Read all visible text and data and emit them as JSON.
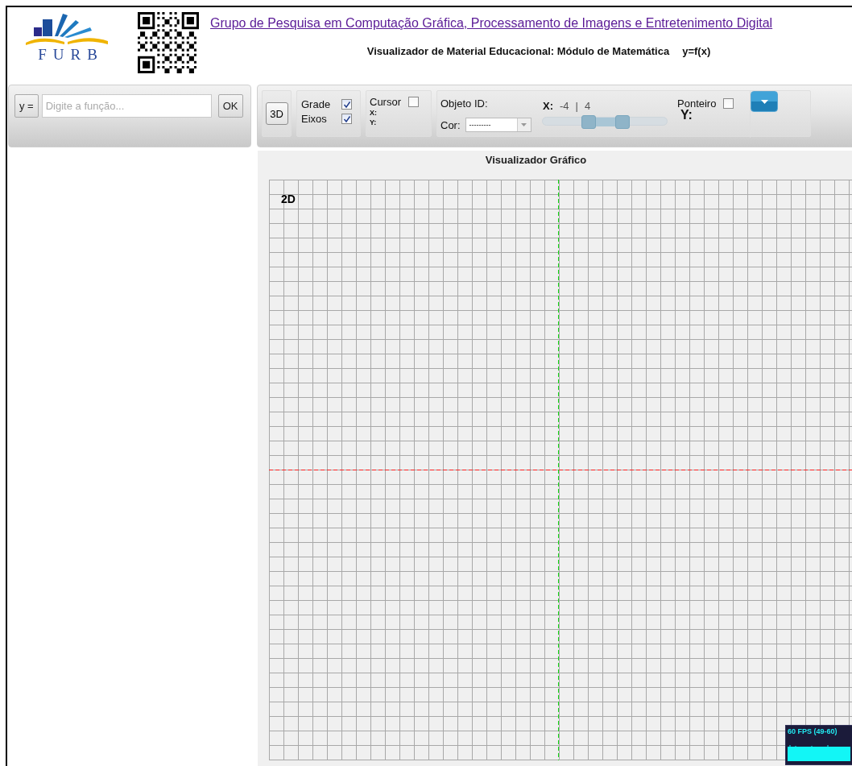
{
  "header": {
    "logo_text": "FURB",
    "link": "Grupo de Pesquisa em Computação Gráfica, Processamento de Imagens e Entretenimento Digital",
    "subtitle": "Visualizador de Material Educacional: Módulo de Matemática",
    "formula": "y=f(x)"
  },
  "function_bar": {
    "prefix_button": "y =",
    "input": {
      "placeholder": "Digite a função..."
    },
    "ok_button": "OK"
  },
  "toolbar": {
    "mode_button": "3D",
    "toggles": [
      {
        "label": "Grade",
        "checked": true
      },
      {
        "label": "Eixos",
        "checked": true
      }
    ],
    "cursor": {
      "label": "Cursor",
      "checked": false,
      "x_label": "X:",
      "y_label": "Y:"
    },
    "object": {
      "id_label": "Objeto ID:",
      "color_label": "Cor:",
      "color_select": "---------",
      "x_label": "X:",
      "x_min": "-4",
      "separator": "|",
      "x_max": "4",
      "thumbs": [
        {
          "level": 0.37
        },
        {
          "level": 0.64
        }
      ],
      "pointer": {
        "label": "Ponteiro",
        "checked": false
      },
      "y_label": "Y:"
    }
  },
  "graph": {
    "title": "Visualizador Gráfico",
    "mode_label": "2D",
    "fps": "60 FPS (49-60)"
  }
}
